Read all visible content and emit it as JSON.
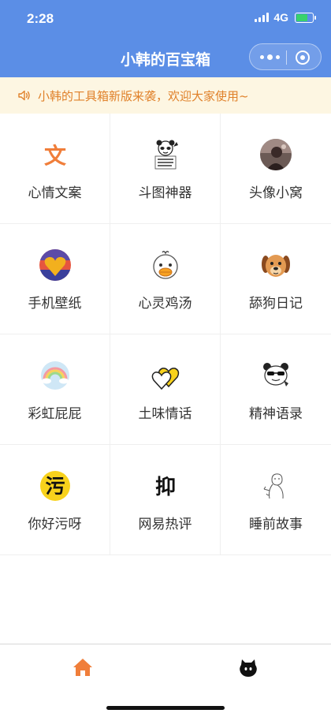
{
  "status": {
    "time": "2:28",
    "network": "4G"
  },
  "nav": {
    "title": "小韩的百宝箱"
  },
  "notice": {
    "text": "小韩的工具箱新版来袭，欢迎大家使用~"
  },
  "tools": [
    {
      "label": "心情文案",
      "icon": "wen-character-icon",
      "glyph": "文"
    },
    {
      "label": "斗图神器",
      "icon": "panda-meme-icon"
    },
    {
      "label": "头像小窝",
      "icon": "avatar-photo-icon"
    },
    {
      "label": "手机壁纸",
      "icon": "heart-wallpaper-icon"
    },
    {
      "label": "心灵鸡汤",
      "icon": "duck-icon"
    },
    {
      "label": "舔狗日记",
      "icon": "dog-icon"
    },
    {
      "label": "彩虹屁屁",
      "icon": "rainbow-icon"
    },
    {
      "label": "土味情话",
      "icon": "double-heart-icon"
    },
    {
      "label": "精神语录",
      "icon": "panda-sunglasses-icon"
    },
    {
      "label": "你好污呀",
      "icon": "wu-character-icon",
      "glyph": "污"
    },
    {
      "label": "网易热评",
      "icon": "yi-character-icon",
      "glyph": "抑"
    },
    {
      "label": "睡前故事",
      "icon": "sketch-figure-icon"
    }
  ],
  "tabbar": {
    "active_color": "#f07e3a"
  },
  "colors": {
    "accent": "#5b8ee6",
    "notice_text": "#e0812a",
    "notice_bg": "#fdf6e2"
  }
}
